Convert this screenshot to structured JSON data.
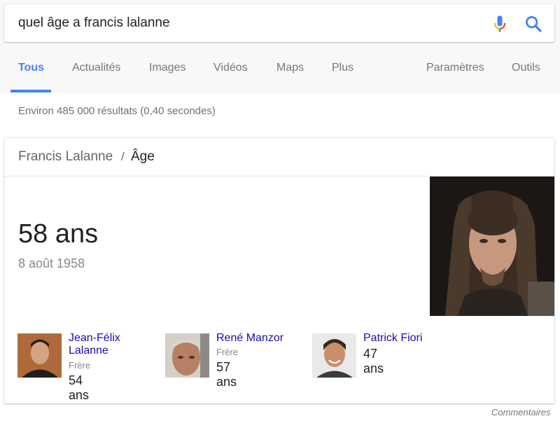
{
  "search": {
    "query": "quel âge a francis lalanne"
  },
  "tabs": [
    {
      "label": "Tous"
    },
    {
      "label": "Actualités"
    },
    {
      "label": "Images"
    },
    {
      "label": "Vidéos"
    },
    {
      "label": "Maps"
    },
    {
      "label": "Plus"
    }
  ],
  "tools": {
    "settings": "Paramètres",
    "tools": "Outils"
  },
  "results_stats": "Environ 485 000 résultats (0,40 secondes)",
  "card": {
    "breadcrumb_entity": "Francis Lalanne",
    "breadcrumb_sep": "/",
    "breadcrumb_attr": "Âge",
    "answer": "58 ans",
    "birth_date": "8 août 1958"
  },
  "related": [
    {
      "name": "Jean-Félix Lalanne",
      "role": "Frère",
      "age": "54 ans"
    },
    {
      "name": "René Manzor",
      "role": "Frère",
      "age": "57 ans"
    },
    {
      "name": "Patrick Fiori",
      "role": "",
      "age": "47 ans"
    }
  ],
  "feedback": "Commentaires",
  "colors": {
    "accent": "#4285f4",
    "link": "#1a0dab",
    "mic_red": "#ea4335",
    "mic_yellow": "#fbbc05",
    "mic_green": "#34a853"
  }
}
